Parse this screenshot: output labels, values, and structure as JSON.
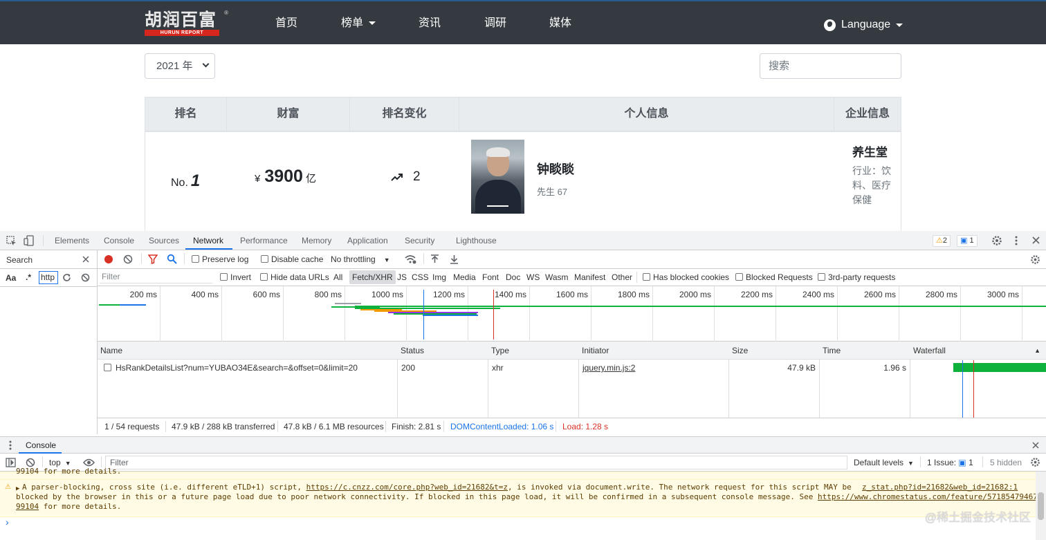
{
  "site": {
    "logo_cn": "胡润百富",
    "logo_en": "HURUN REPORT",
    "logo_reg": "®",
    "nav": [
      "首页",
      "榜单",
      "资讯",
      "调研",
      "媒体"
    ],
    "language": "Language",
    "year_select": "2021 年",
    "search_placeholder": "搜索",
    "table_headers": [
      "排名",
      "财富",
      "排名变化",
      "个人信息",
      "企业信息"
    ],
    "row": {
      "rank_prefix": "No.",
      "rank": "1",
      "currency": "¥",
      "wealth": "3900",
      "wealth_unit": "亿",
      "rank_change": "2",
      "name": "钟睒睒",
      "meta": "先生  67",
      "company": "养生堂",
      "industry": "行业：饮料、医疗保健"
    }
  },
  "devtools": {
    "tabs": [
      "Elements",
      "Console",
      "Sources",
      "Network",
      "Performance",
      "Memory",
      "Application",
      "Security",
      "Lighthouse"
    ],
    "active_tab": "Network",
    "warnings_count": "2",
    "messages_count": "1",
    "search_label": "Search",
    "search_aa": "Aa",
    "search_regex": ".*",
    "search_input_value": "http",
    "preserve_log": "Preserve log",
    "disable_cache": "Disable cache",
    "throttling": "No throttling",
    "filter_placeholder": "Filter",
    "invert": "Invert",
    "hide_data_urls": "Hide data URLs",
    "type_filters": [
      "All",
      "Fetch/XHR",
      "JS",
      "CSS",
      "Img",
      "Media",
      "Font",
      "Doc",
      "WS",
      "Wasm",
      "Manifest",
      "Other"
    ],
    "active_type_filter": "Fetch/XHR",
    "has_blocked_cookies": "Has blocked cookies",
    "blocked_requests": "Blocked Requests",
    "third_party": "3rd-party requests",
    "timeline_ticks": [
      "200 ms",
      "400 ms",
      "600 ms",
      "800 ms",
      "1000 ms",
      "1200 ms",
      "1400 ms",
      "1600 ms",
      "1800 ms",
      "2000 ms",
      "2200 ms",
      "2400 ms",
      "2600 ms",
      "2800 ms",
      "3000 ms"
    ],
    "columns": [
      "Name",
      "Status",
      "Type",
      "Initiator",
      "Size",
      "Time",
      "Waterfall"
    ],
    "request": {
      "name": "HsRankDetailsList?num=YUBAO34E&search=&offset=0&limit=20",
      "status": "200",
      "type": "xhr",
      "initiator": "jquery.min.js:2",
      "size": "47.9 kB",
      "time": "1.96 s"
    },
    "status_bar": {
      "requests": "1 / 54 requests",
      "transferred": "47.9 kB / 288 kB transferred",
      "resources": "47.8 kB / 6.1 MB resources",
      "finish": "Finish: 2.81 s",
      "dom_loaded": "DOMContentLoaded: 1.06 s",
      "load": "Load: 1.28 s"
    },
    "drawer_tab": "Console",
    "console_context": "top",
    "console_filter": "Filter",
    "default_levels": "Default levels",
    "issues": "1 Issue:",
    "issues_count": "1",
    "hidden": "5 hidden",
    "console_lines": {
      "line0": "99104 for more details.",
      "line1a": "A parser-blocking, cross site (i.e. different eTLD+1) script, ",
      "line1_link": "https://c.cnzz.com/core.php?web_id=21682&t=z",
      "line1b": ", is invoked via document.write. The network request for this script MAY be",
      "line1_src": "z_stat.php?id=21682&web_id=21682:1",
      "line2a": "blocked by the browser in this or a future page load due to poor network connectivity. If blocked in this page load, it will be confirmed in a subsequent console message. See ",
      "line2_link": "https://www.chromestatus.com/feature/57185479467",
      "line3_link": "99104",
      "line3b": " for more details."
    },
    "prompt": "›"
  },
  "watermark": "@稀土掘金技术社区",
  "colors": {
    "navbar": "#343a40",
    "accent_blue": "#1a73e8",
    "record_red": "#d93025",
    "waterfall_green": "#0eb13b"
  }
}
